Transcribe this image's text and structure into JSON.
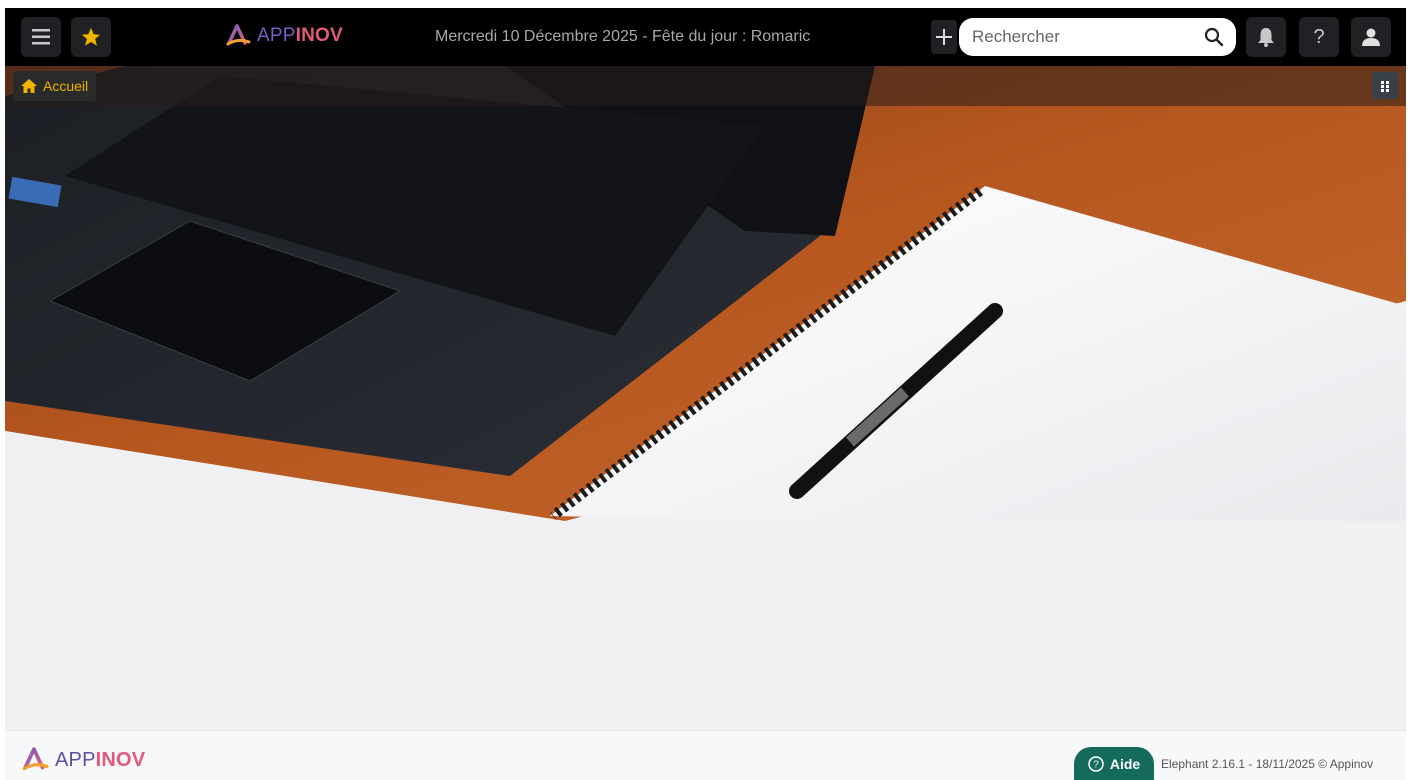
{
  "header": {
    "app_name_prefix": "APP",
    "app_name_suffix": "INOV",
    "date_line": "Mercredi 10 Décembre 2025 - Fête du jour : Romaric",
    "search_placeholder": "Rechercher",
    "icons": [
      "menu-icon",
      "star-icon",
      "plus-icon",
      "search-icon",
      "bell-icon",
      "help-icon",
      "user-icon"
    ]
  },
  "breadcrumb": {
    "home_label": "Accueil"
  },
  "footer": {
    "logo_prefix": "APP",
    "logo_suffix": "INOV",
    "help_label": "Aide",
    "version_text": "Elephant 2.16.1 - 18/11/2025 © Appinov"
  },
  "colors": {
    "accent_yellow": "#f0b400",
    "brand_purple": "#7c5cc9",
    "brand_pink": "#e05a7a",
    "help_green": "#146b5c"
  }
}
